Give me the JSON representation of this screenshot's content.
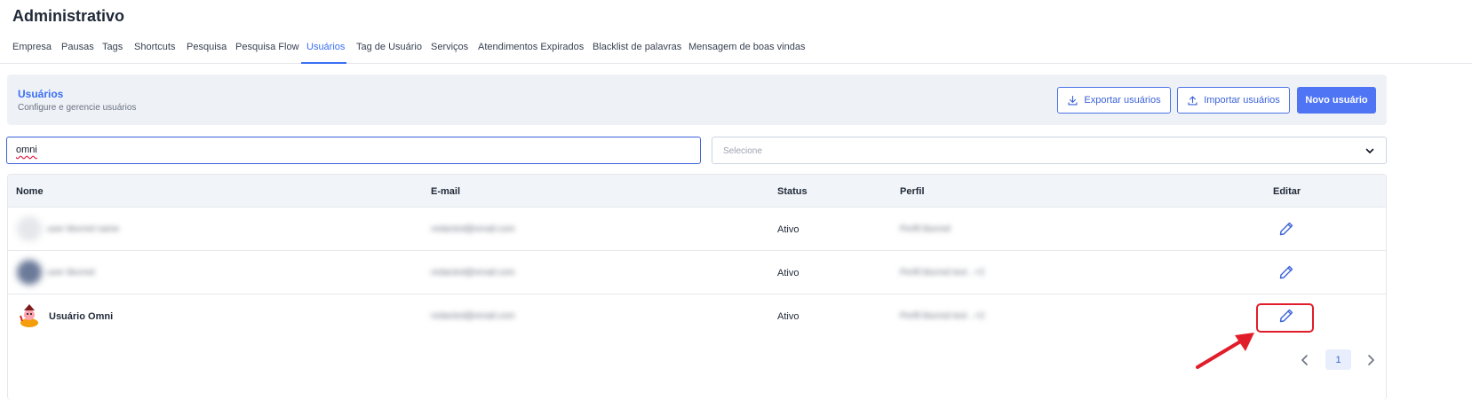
{
  "page": {
    "title": "Administrativo"
  },
  "tabs": [
    {
      "label": "Empresa",
      "active": false
    },
    {
      "label": "Pausas",
      "active": false
    },
    {
      "label": "Tags",
      "active": false
    },
    {
      "label": "Shortcuts",
      "active": false
    },
    {
      "label": "Pesquisa",
      "active": false
    },
    {
      "label": "Pesquisa Flow",
      "active": false
    },
    {
      "label": "Usuários",
      "active": true
    },
    {
      "label": "Tag de Usuário",
      "active": false
    },
    {
      "label": "Serviços",
      "active": false
    },
    {
      "label": "Atendimentos Expirados",
      "active": false
    },
    {
      "label": "Blacklist de palavras",
      "active": false
    },
    {
      "label": "Mensagem de boas vindas",
      "active": false
    }
  ],
  "header": {
    "title": "Usuários",
    "subtitle": "Configure e gerencie usuários",
    "export_label": "Exportar usuários",
    "import_label": "Importar usuários",
    "new_label": "Novo usuário"
  },
  "filters": {
    "search_value": "omni",
    "select_placeholder": "Selecione"
  },
  "table": {
    "columns": {
      "name": "Nome",
      "email": "E-mail",
      "status": "Status",
      "profile": "Perfil",
      "edit": "Editar"
    },
    "rows": [
      {
        "name": "user blurred name",
        "email": "redacted@email.com",
        "status": "Ativo",
        "profile": "Perfil blurred",
        "redacted": true
      },
      {
        "name": "user blurred",
        "email": "redacted@email.com",
        "status": "Ativo",
        "profile": "Perfil blurred text ..+2",
        "redacted": true
      },
      {
        "name": "Usuário Omni",
        "email": "redacted@email.com",
        "status": "Ativo",
        "profile": "Perfil blurred text ..+2",
        "redacted": false
      }
    ]
  },
  "pagination": {
    "current_page": "1"
  },
  "colors": {
    "accent": "#3b6ff5",
    "primary_button": "#4f75f4",
    "highlight": "#e11d2a"
  }
}
